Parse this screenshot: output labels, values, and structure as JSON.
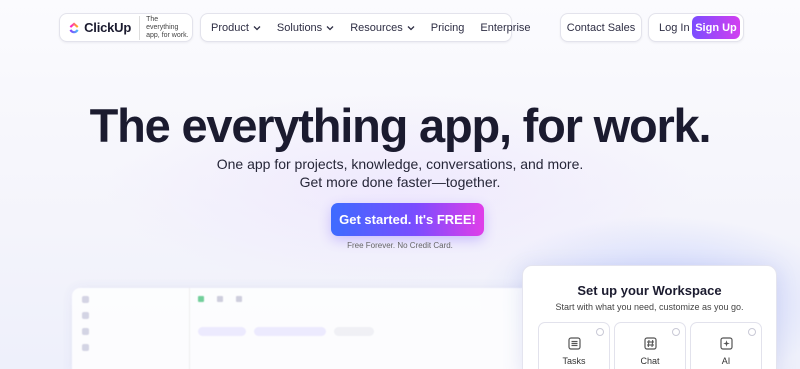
{
  "brand": {
    "name": "ClickUp",
    "tagline": "The everything app, for work.",
    "colors": {
      "accent_purple": "#7b4dff",
      "accent_pink": "#e03ee8",
      "accent_blue": "#3d6bff"
    }
  },
  "nav": {
    "menu": [
      {
        "label": "Product",
        "has_dropdown": true
      },
      {
        "label": "Solutions",
        "has_dropdown": true
      },
      {
        "label": "Resources",
        "has_dropdown": true
      },
      {
        "label": "Pricing",
        "has_dropdown": false
      },
      {
        "label": "Enterprise",
        "has_dropdown": false
      }
    ],
    "contact_sales": "Contact Sales",
    "login": "Log In",
    "signup": "Sign Up"
  },
  "hero": {
    "title": "The everything app, for work.",
    "subtitle_line1": "One app for projects, knowledge, conversations, and more.",
    "subtitle_line2": "Get more done faster—together.",
    "cta": "Get started. It's FREE!",
    "note": "Free Forever. No Credit Card."
  },
  "workspace_card": {
    "title": "Set up your Workspace",
    "subtitle": "Start with what you need, customize as you go.",
    "options": [
      {
        "label": "Tasks",
        "icon": "tasks-icon"
      },
      {
        "label": "Chat",
        "icon": "chat-icon"
      },
      {
        "label": "AI",
        "icon": "ai-icon"
      }
    ]
  }
}
